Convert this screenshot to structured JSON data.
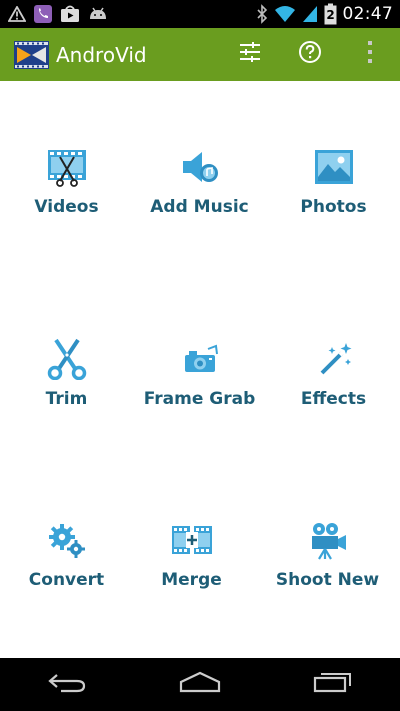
{
  "status_bar": {
    "time": "02:47",
    "left_icons": [
      "warning-icon",
      "viber-icon",
      "play-store-icon",
      "android-icon"
    ],
    "right_icons": [
      "bluetooth-icon",
      "wifi-icon",
      "signal-icon",
      "battery-icon"
    ],
    "battery_level": "2"
  },
  "app_bar": {
    "title": "AndroVid",
    "background": "#6a9d1f",
    "actions": [
      "settings-sliders-icon",
      "help-icon",
      "overflow-menu-icon"
    ]
  },
  "grid": {
    "label_color": "#1e5d76",
    "icon_color": "#3aa3d8",
    "tiles": [
      {
        "label": "Videos",
        "icon": "film-scissors-icon"
      },
      {
        "label": "Add Music",
        "icon": "music-speaker-icon"
      },
      {
        "label": "Photos",
        "icon": "photo-icon"
      },
      {
        "label": "Trim",
        "icon": "scissors-icon"
      },
      {
        "label": "Frame Grab",
        "icon": "camera-icon"
      },
      {
        "label": "Effects",
        "icon": "magic-wand-icon"
      },
      {
        "label": "Convert",
        "icon": "gears-icon"
      },
      {
        "label": "Merge",
        "icon": "film-merge-icon"
      },
      {
        "label": "Shoot New",
        "icon": "video-camera-icon"
      }
    ]
  },
  "nav_bar": {
    "buttons": [
      "back-icon",
      "home-icon",
      "recent-apps-icon"
    ]
  }
}
